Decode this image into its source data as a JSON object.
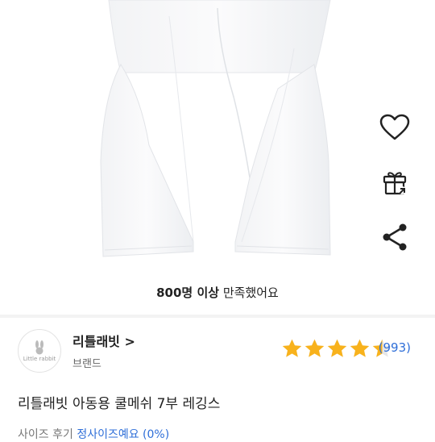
{
  "product": {
    "satisfaction_bold": "800명 이상",
    "satisfaction_text": "만족했어요",
    "title": "리틀래빗 아동용 쿨메쉬 7부 레깅스"
  },
  "brand": {
    "logo_text": "Little rabbit",
    "name": "리틀래빗 >",
    "label": "브랜드"
  },
  "rating": {
    "stars": 4.5,
    "review_count": "(993)"
  },
  "size_line": {
    "label": "사이즈 후기",
    "value": "정사이즈예요 (0%)"
  },
  "icons": {
    "wishlist": "heart-outline-icon",
    "gift": "gift-icon",
    "share": "share-icon"
  },
  "colors": {
    "star": "#f8b21c",
    "link": "#2f6fd8"
  }
}
